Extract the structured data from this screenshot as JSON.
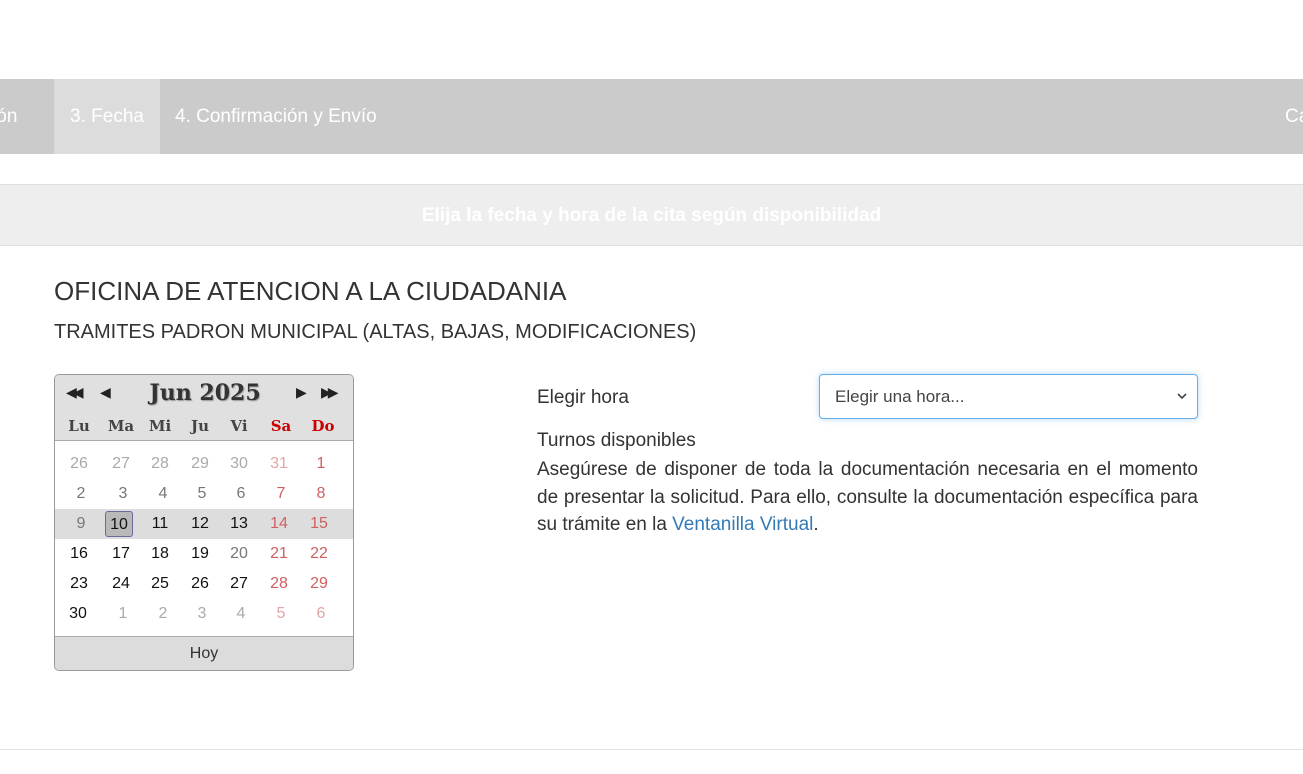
{
  "steps": {
    "step2_label": "ación",
    "step3_label": "3. Fecha",
    "step4_label": "4. Confirmación y Envío",
    "cancel_label": "Ca"
  },
  "banner": {
    "text": "Elija la fecha y hora de la cita según disponibilidad"
  },
  "office": {
    "title": "OFICINA DE ATENCION A LA CIUDADANIA",
    "service": "TRAMITES PADRON MUNICIPAL (ALTAS, BAJAS, MODIFICACIONES)"
  },
  "calendar": {
    "month_label": "Jun 2025",
    "nav": {
      "prev_year": "◀◀",
      "prev_month": "◀",
      "next_month": "▶",
      "next_year": "▶▶"
    },
    "weekdays": [
      "Lu",
      "Ma",
      "Mi",
      "Ju",
      "Vi",
      "Sa",
      "Do"
    ],
    "weeks": [
      [
        "26",
        "27",
        "28",
        "29",
        "30",
        "31",
        "1"
      ],
      [
        "2",
        "3",
        "4",
        "5",
        "6",
        "7",
        "8"
      ],
      [
        "9",
        "10",
        "11",
        "12",
        "13",
        "14",
        "15"
      ],
      [
        "16",
        "17",
        "18",
        "19",
        "20",
        "21",
        "22"
      ],
      [
        "23",
        "24",
        "25",
        "26",
        "27",
        "28",
        "29"
      ],
      [
        "30",
        "1",
        "2",
        "3",
        "4",
        "5",
        "6"
      ]
    ],
    "today_label": "Hoy",
    "colors": {
      "weekend": "#c00000",
      "header_bg": "#e0e0e0"
    }
  },
  "time": {
    "label": "Elegir hora",
    "select_value": "Elegir una hora...",
    "chevron": "chevron-down-icon"
  },
  "turnos": {
    "label": "Turnos disponibles"
  },
  "info": {
    "text_before": "Asegúrese de disponer de toda la documentación necesaria en el momento de presentar la solicitud. Para ello, consulte la documentación específica para su trámite en la ",
    "link_text": "Ventanilla Virtual",
    "text_after": "."
  }
}
